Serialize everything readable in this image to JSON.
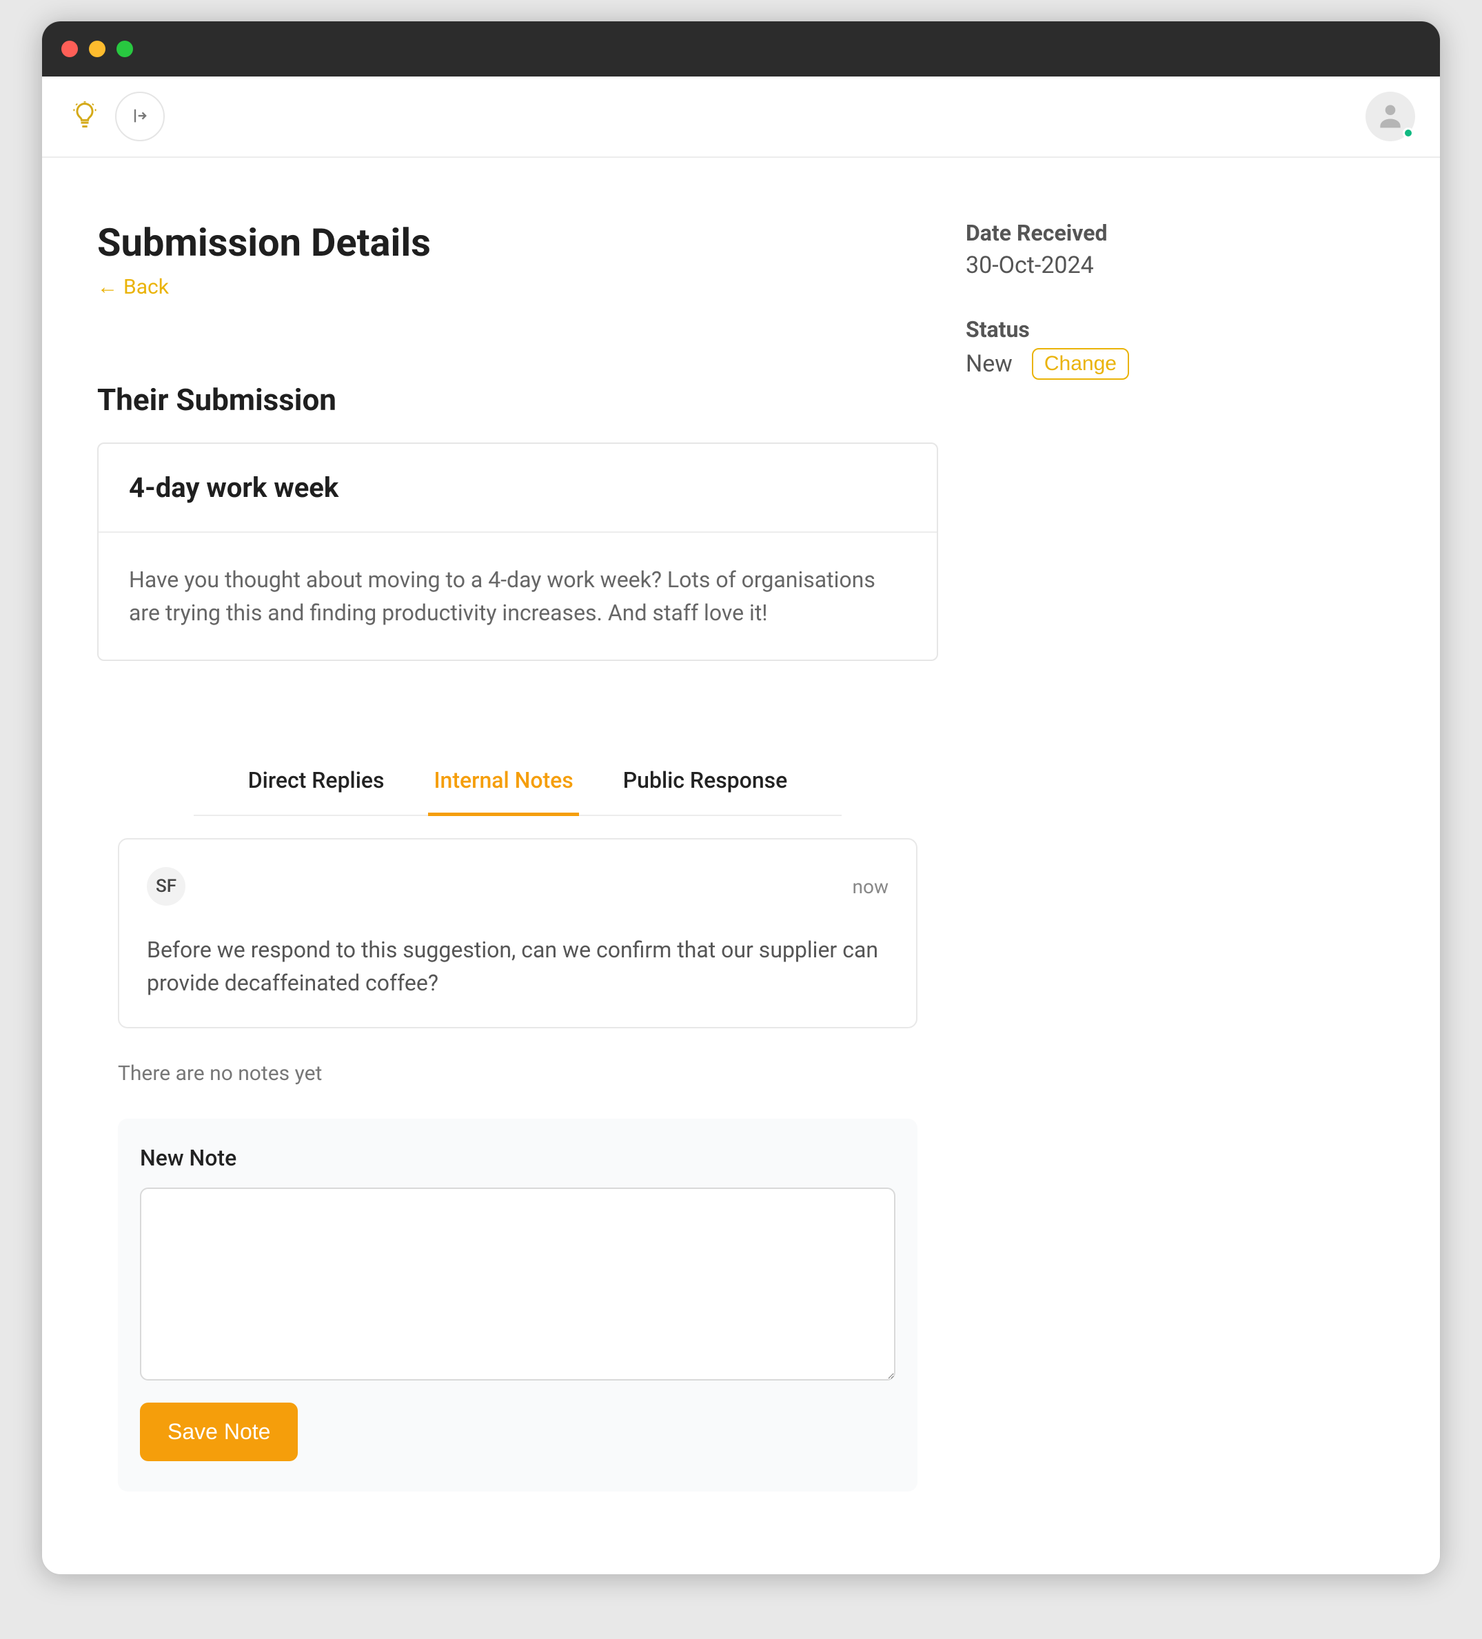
{
  "header": {
    "logo_icon": "lightbulb-icon",
    "toggle_icon": "sidebar-toggle-icon",
    "avatar_icon": "user-icon"
  },
  "page": {
    "title": "Submission Details",
    "back_label": "Back",
    "back_arrow": "←"
  },
  "side": {
    "date_label": "Date Received",
    "date_value": "30-Oct-2024",
    "status_label": "Status",
    "status_value": "New",
    "change_label": "Change"
  },
  "submission": {
    "section_title": "Their Submission",
    "title": "4-day work week",
    "body": "Have you thought about moving to a 4-day work week? Lots of organisations are trying this and finding productivity increases. And staff love it!"
  },
  "tabs": {
    "direct_replies": "Direct Replies",
    "internal_notes": "Internal Notes",
    "public_response": "Public Response",
    "active": "internal_notes"
  },
  "notes": [
    {
      "initials": "SF",
      "time": "now",
      "body": "Before we respond to this suggestion, can we confirm that our supplier can provide decaffeinated coffee?"
    }
  ],
  "empty_notes_text": "There are no notes yet",
  "new_note": {
    "label": "New Note",
    "value": "",
    "save_label": "Save Note"
  }
}
